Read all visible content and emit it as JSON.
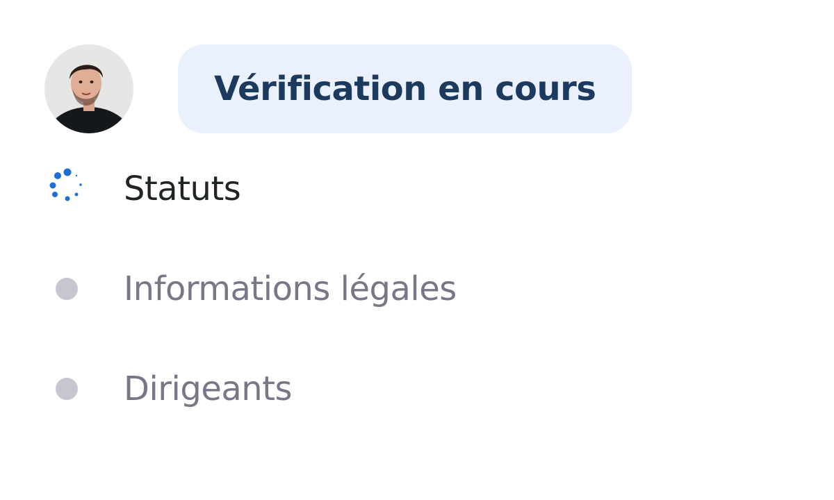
{
  "header": {
    "status_label": "Vérification en cours"
  },
  "steps": [
    {
      "label": "Statuts",
      "state": "in-progress"
    },
    {
      "label": "Informations légales",
      "state": "pending"
    },
    {
      "label": "Dirigeants",
      "state": "pending"
    }
  ],
  "colors": {
    "accent": "#1e6ed8",
    "status_pill_bg": "#eaf1fd",
    "status_pill_text": "#1c3a5e",
    "active_text": "#1f2426",
    "pending_text": "#767787",
    "pending_dot": "#c6c6ce"
  }
}
